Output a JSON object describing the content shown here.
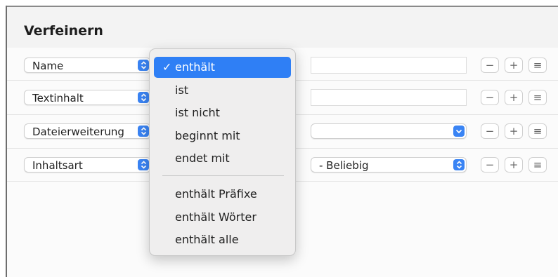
{
  "title": "Verfeinern",
  "rows": [
    {
      "attribute": "Name"
    },
    {
      "attribute": "Textinhalt"
    },
    {
      "attribute": "Dateierweiterung"
    },
    {
      "attribute": "Inhaltsart",
      "value": "- Beliebig"
    }
  ],
  "buttons": {
    "minus": "−",
    "plus": "+",
    "more": "≡"
  },
  "menu": {
    "checkmark": "✓",
    "items": [
      "enthält",
      "ist",
      "ist nicht",
      "beginnt mit",
      "endet mit"
    ],
    "items2": [
      "enthält Präfixe",
      "enthält Wörter",
      "enthält alle"
    ],
    "selected": "enthält"
  },
  "colors": {
    "accent": "#2f7ff5",
    "chevron": "#3a84f4"
  }
}
